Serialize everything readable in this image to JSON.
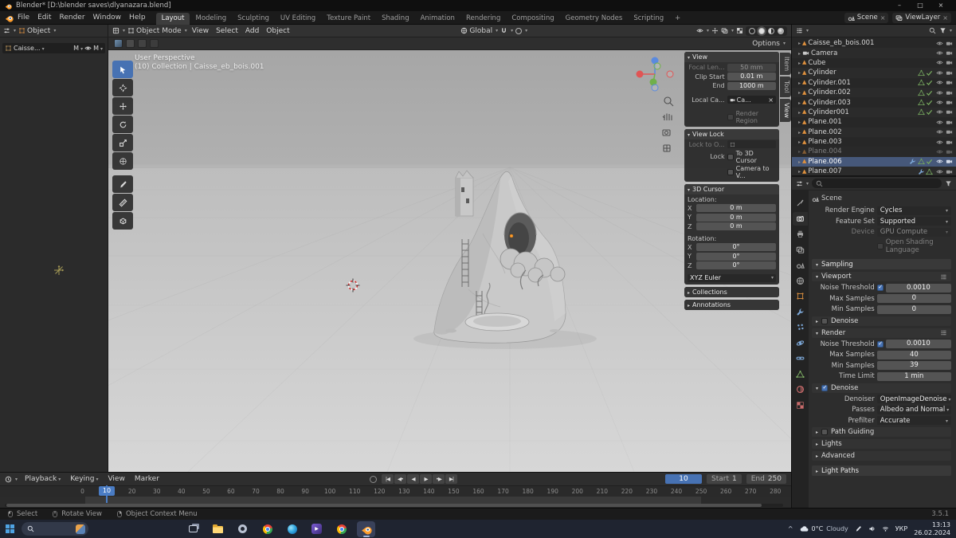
{
  "colors": {
    "accent": "#4772b3",
    "blender_orange": "#e87d0d",
    "selection": "#46587a"
  },
  "titlebar": {
    "title": "Blender* [D:\\blender saves\\dlyanazara.blend]",
    "min": "–",
    "max": "□",
    "close": "×"
  },
  "topbar": {
    "menus": [
      "File",
      "Edit",
      "Render",
      "Window",
      "Help"
    ],
    "workspaces": [
      "Layout",
      "Modeling",
      "Sculpting",
      "UV Editing",
      "Texture Paint",
      "Shading",
      "Animation",
      "Rendering",
      "Compositing",
      "Geometry Nodes",
      "Scripting"
    ],
    "add_tab": "+",
    "scene": "Scene",
    "viewlayer": "ViewLayer",
    "clear": "×"
  },
  "left_panel": {
    "editor_label": "Object",
    "slot_name": "Caisse...",
    "badge_a": "M",
    "badge_b": "M"
  },
  "viewport": {
    "header": {
      "mode": "Object Mode",
      "menu_view": "View",
      "menu_select": "Select",
      "menu_add": "Add",
      "menu_object": "Object",
      "orientation": "Global"
    },
    "tool_settings_options": "Options",
    "overlay_line1": "User Perspective",
    "overlay_line2": "(10) Collection | Caisse_eb_bois.001",
    "sidebar_tabs": {
      "item": "Item",
      "tool": "Tool",
      "view": "View"
    },
    "npanel": {
      "view": {
        "title": "View",
        "focal_label": "Focal Len...",
        "focal": "50 mm",
        "clip_start_label": "Clip Start",
        "clip_start": "0.01 m",
        "clip_end_label": "End",
        "clip_end": "1000 m",
        "local_camera_label": "Local Ca...",
        "local_camera": "Ca...",
        "clear": "×",
        "render_region": "Render Region"
      },
      "view_lock": {
        "title": "View Lock",
        "lock_to_object": "Lock to O...",
        "lock": "Lock",
        "to_3d_cursor": "To 3D Cursor",
        "camera_to_view": "Camera to V..."
      },
      "cursor": {
        "title": "3D Cursor",
        "location_label": "Location:",
        "rotation_label": "Rotation:",
        "location": [
          {
            "axis": "X",
            "value": "0 m"
          },
          {
            "axis": "Y",
            "value": "0 m"
          },
          {
            "axis": "Z",
            "value": "0 m"
          }
        ],
        "rotation": [
          {
            "axis": "X",
            "value": "0°"
          },
          {
            "axis": "Y",
            "value": "0°"
          },
          {
            "axis": "Z",
            "value": "0°"
          }
        ],
        "rotation_mode": "XYZ Euler"
      },
      "collections": "Collections",
      "annotations": "Annotations"
    }
  },
  "outliner": {
    "rows": [
      {
        "name": "Caisse_eb_bois.001"
      },
      {
        "name": "Camera"
      },
      {
        "name": "Cube"
      },
      {
        "name": "Cylinder"
      },
      {
        "name": "Cylinder.001"
      },
      {
        "name": "Cylinder.002"
      },
      {
        "name": "Cylinder.003"
      },
      {
        "name": "Cylinder001"
      },
      {
        "name": "Plane.001"
      },
      {
        "name": "Plane.002"
      },
      {
        "name": "Plane.003"
      },
      {
        "name": "Plane.004"
      },
      {
        "name": "Plane.006"
      },
      {
        "name": "Plane.007"
      }
    ]
  },
  "properties": {
    "breadcrumb": "Scene",
    "render_engine_label": "Render Engine",
    "render_engine": "Cycles",
    "feature_set_label": "Feature Set",
    "feature_set": "Supported",
    "device_label": "Device",
    "device": "GPU Compute",
    "osl": "Open Shading Language",
    "sampling_title": "Sampling",
    "viewport_title": "Viewport",
    "vp_noise_label": "Noise Threshold",
    "vp_noise": "0.0010",
    "vp_max_label": "Max Samples",
    "vp_max": "0",
    "vp_min_label": "Min Samples",
    "vp_min": "0",
    "vp_denoise": "Denoise",
    "render_title": "Render",
    "r_noise_label": "Noise Threshold",
    "r_noise": "0.0010",
    "r_max_label": "Max Samples",
    "r_max": "40",
    "r_min_label": "Min Samples",
    "r_min": "39",
    "time_limit_label": "Time Limit",
    "time_limit": "1 min",
    "denoise_title": "Denoise",
    "denoiser_label": "Denoiser",
    "denoiser": "OpenImageDenoise",
    "passes_label": "Passes",
    "passes": "Albedo and Normal",
    "prefilter_label": "Prefilter",
    "prefilter": "Accurate",
    "path_guiding": "Path Guiding",
    "lights": "Lights",
    "advanced": "Advanced",
    "light_paths": "Light Paths"
  },
  "timeline": {
    "playback": "Playback",
    "keying": "Keying",
    "view": "View",
    "marker": "Marker",
    "current_frame": "10",
    "start_label": "Start",
    "start": "1",
    "end_label": "End",
    "end": "250",
    "transport": [
      "|◀",
      "◀•",
      "◀",
      "▶",
      "•▶",
      "▶|"
    ],
    "ruler": [
      "0",
      "10",
      "20",
      "30",
      "40",
      "50",
      "60",
      "70",
      "80",
      "90",
      "100",
      "110",
      "120",
      "130",
      "140",
      "150",
      "160",
      "170",
      "180",
      "190",
      "200",
      "210",
      "220",
      "230",
      "240",
      "250",
      "260",
      "270",
      "280"
    ]
  },
  "statusbar": {
    "hint_select": "Select",
    "hint_rotate": "Rotate View",
    "hint_context": "Object Context Menu",
    "version": "3.5.1"
  },
  "taskbar": {
    "tray_expand": "^",
    "weather_temp": "0°C",
    "weather_cond": "Cloudy",
    "language": "УКР",
    "time": "13:13",
    "date": "26.02.2024"
  }
}
